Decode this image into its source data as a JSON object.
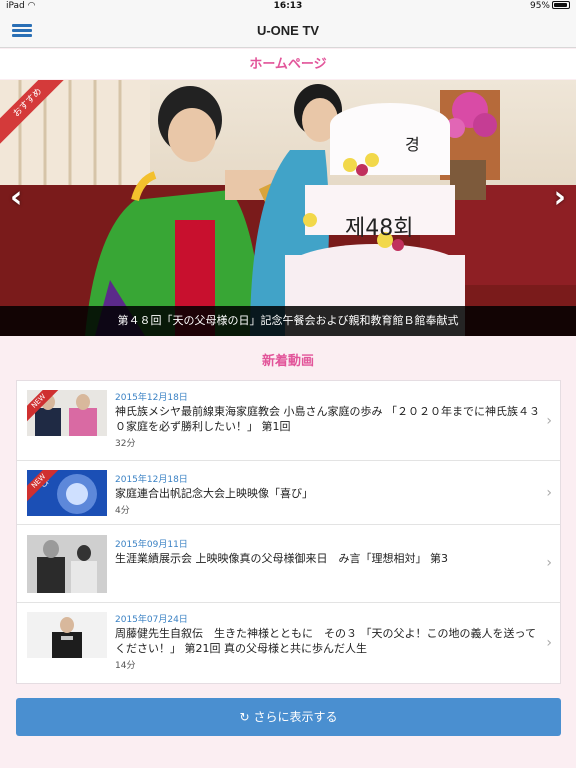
{
  "status_bar": {
    "device": "iPad",
    "wifi_icon": "wifi-icon",
    "time": "16:13",
    "battery_percent": "95%",
    "battery_level": 0.95
  },
  "nav": {
    "title": "U-ONE TV",
    "menu_icon": "hamburger-menu-icon"
  },
  "home_header": "ホームページ",
  "hero": {
    "badge": "おすすめ",
    "caption": "第４８回「天の父母様の日」記念午餐会および親和教育館Ｂ館奉献式",
    "prev_icon": "chevron-left-icon",
    "next_icon": "chevron-right-icon",
    "cake_text": "제48회"
  },
  "new_videos": {
    "title": "新着動画",
    "new_label": "NEW",
    "items": [
      {
        "date": "2015年12月18日",
        "title": "神氏族メシヤ最前線東海家庭教会 小島さん家庭の歩み 「２０２０年までに神氏族４３０家庭を必ず勝利したい！」 第1回",
        "duration": "32分",
        "is_new": true
      },
      {
        "date": "2015年12月18日",
        "title": "家庭連合出帆記念大会上映映像「喜び」",
        "duration": "4分",
        "is_new": true,
        "thumb_text": "喜び"
      },
      {
        "date": "2015年09月11日",
        "title": "生涯業績展示会 上映映像真の父母様御来日　み言「理想相対」 第3",
        "duration": "",
        "is_new": false
      },
      {
        "date": "2015年07月24日",
        "title": "周藤健先生自叙伝　生きた神様とともに　その３ 「天の父よ！この地の義人を送ってください！」 第21回 真の父母様と共に歩んだ人生",
        "duration": "14分",
        "is_new": false
      }
    ]
  },
  "more_button": {
    "label": "さらに表示する",
    "icon": "refresh-icon"
  },
  "colors": {
    "accent_pink": "#e2559a",
    "link_blue": "#3b82c4",
    "button_blue": "#4a8fd0",
    "ribbon_red": "#d43a3a"
  }
}
